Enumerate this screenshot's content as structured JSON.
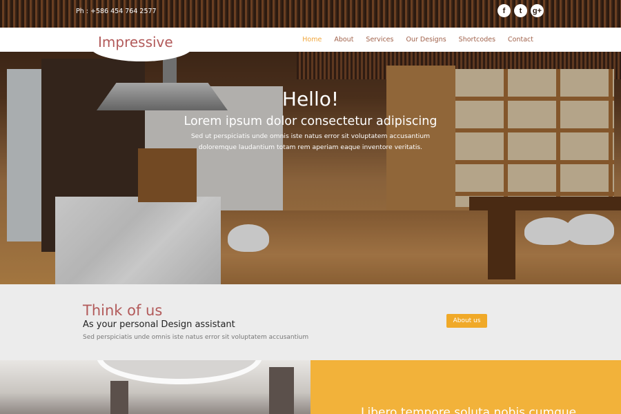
{
  "topbar": {
    "phone": "Ph : +586 454 764 2577",
    "social": [
      {
        "icon": "facebook-icon",
        "glyph": "f"
      },
      {
        "icon": "twitter-icon",
        "glyph": "t"
      },
      {
        "icon": "google-plus-icon",
        "glyph": "g+"
      }
    ]
  },
  "brand": {
    "logo": "Impressive"
  },
  "nav": {
    "items": [
      "Home",
      "About",
      "Services",
      "Our Designs",
      "Shortcodes",
      "Contact"
    ],
    "active": "Home"
  },
  "hero": {
    "title": "Hello!",
    "subtitle": "Lorem ipsum dolor consectetur adipiscing",
    "body": "Sed ut perspiciatis unde omnis iste natus error sit voluptatem accusantium doloremque laudantium totam rem aperiam eaque inventore veritatis."
  },
  "about": {
    "title": "Think of us",
    "subtitle": "As your personal Design assistant",
    "text": "Sed perspiciatis unde omnis iste natus error sit voluptatem accusantium",
    "button": "About us"
  },
  "bottom": {
    "teaser": "Libero tempore soluta nobis cumque"
  },
  "colors": {
    "accent": "#f0a928",
    "brand": "#b25a5a",
    "nav_active": "#f0a53a",
    "about_bg": "#ececec",
    "bottom_panel": "#f2b23a"
  }
}
